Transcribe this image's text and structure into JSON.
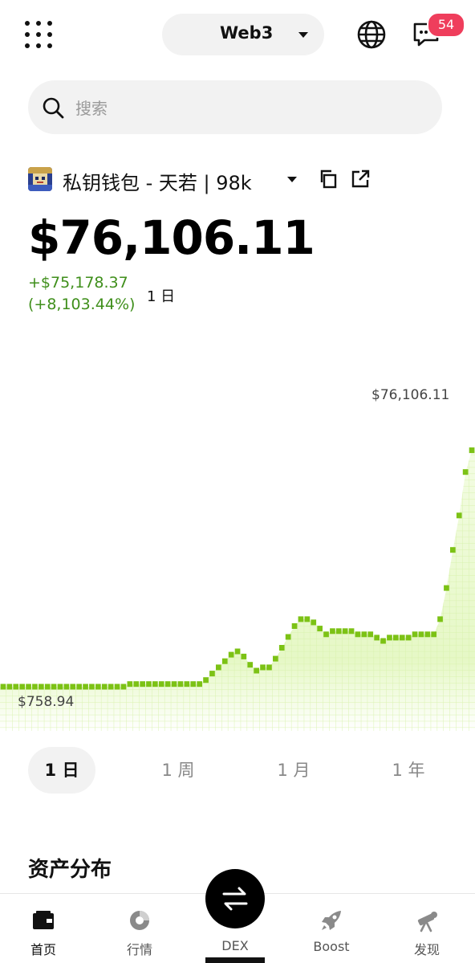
{
  "header": {
    "network": "Web3",
    "notification_count": "54"
  },
  "search": {
    "placeholder": "搜索",
    "value": ""
  },
  "wallet": {
    "name": "私钥钱包 - 天若 | 98k",
    "balance": "$76,106.11",
    "change_abs": "+$75,178.37",
    "change_pct": "(+8,103.44%)",
    "change_period": "1 日"
  },
  "chart_data": {
    "type": "line",
    "title": "",
    "max_label": "$76,106.11",
    "min_label": "$758.94",
    "x": [
      0,
      1,
      2,
      3,
      4,
      5,
      6,
      7,
      8,
      9,
      10,
      11,
      12,
      13,
      14,
      15,
      16,
      17,
      18,
      19,
      20,
      21,
      22,
      23,
      24,
      25,
      26,
      27,
      28,
      29,
      30,
      31,
      32,
      33,
      34,
      35,
      36,
      37,
      38,
      39,
      40,
      41,
      42,
      43,
      44,
      45,
      46,
      47,
      48,
      49,
      50,
      51,
      52,
      53,
      54,
      55,
      56,
      57,
      58,
      59,
      60,
      61,
      62,
      63,
      64,
      65,
      66,
      67,
      68,
      69,
      70,
      71,
      72,
      73,
      74
    ],
    "values": [
      758.94,
      758.94,
      758.94,
      758.94,
      758.94,
      758.94,
      758.94,
      758.94,
      758.94,
      758.94,
      758.94,
      758.94,
      758.94,
      758.94,
      758.94,
      758.94,
      758.94,
      758.94,
      758.94,
      758.94,
      1500,
      1500,
      1500,
      1500,
      1500,
      1500,
      1500,
      1500,
      1500,
      1500,
      1500,
      1500,
      2600,
      4400,
      6100,
      7800,
      9600,
      10500,
      9100,
      6800,
      5200,
      6100,
      6100,
      8500,
      11500,
      14500,
      17500,
      19400,
      19400,
      18500,
      16800,
      15200,
      16100,
      16100,
      16100,
      16100,
      15200,
      15200,
      15200,
      14300,
      13400,
      14300,
      14300,
      14300,
      14300,
      15200,
      15200,
      15200,
      15200,
      19400,
      28000,
      38500,
      48000,
      60000,
      66000
    ],
    "ylim": [
      0,
      76106.11
    ],
    "colors": {
      "line": "#7cc215",
      "fill": "#e8f9c8",
      "grid": "#cfeea0"
    }
  },
  "ranges": [
    "1 日",
    "1 周",
    "1 月",
    "1 年"
  ],
  "active_range": "1 日",
  "section": {
    "assets_title": "资产分布"
  },
  "nav": {
    "home": "首页",
    "market": "行情",
    "dex": "DEX",
    "boost": "Boost",
    "discover": "发现"
  },
  "icons": [
    "apps-grid-icon",
    "globe-icon",
    "message-icon",
    "search-icon",
    "copy-icon",
    "external-link-icon",
    "wallet-icon",
    "market-icon",
    "swap-icon",
    "rocket-icon",
    "telescope-icon"
  ]
}
